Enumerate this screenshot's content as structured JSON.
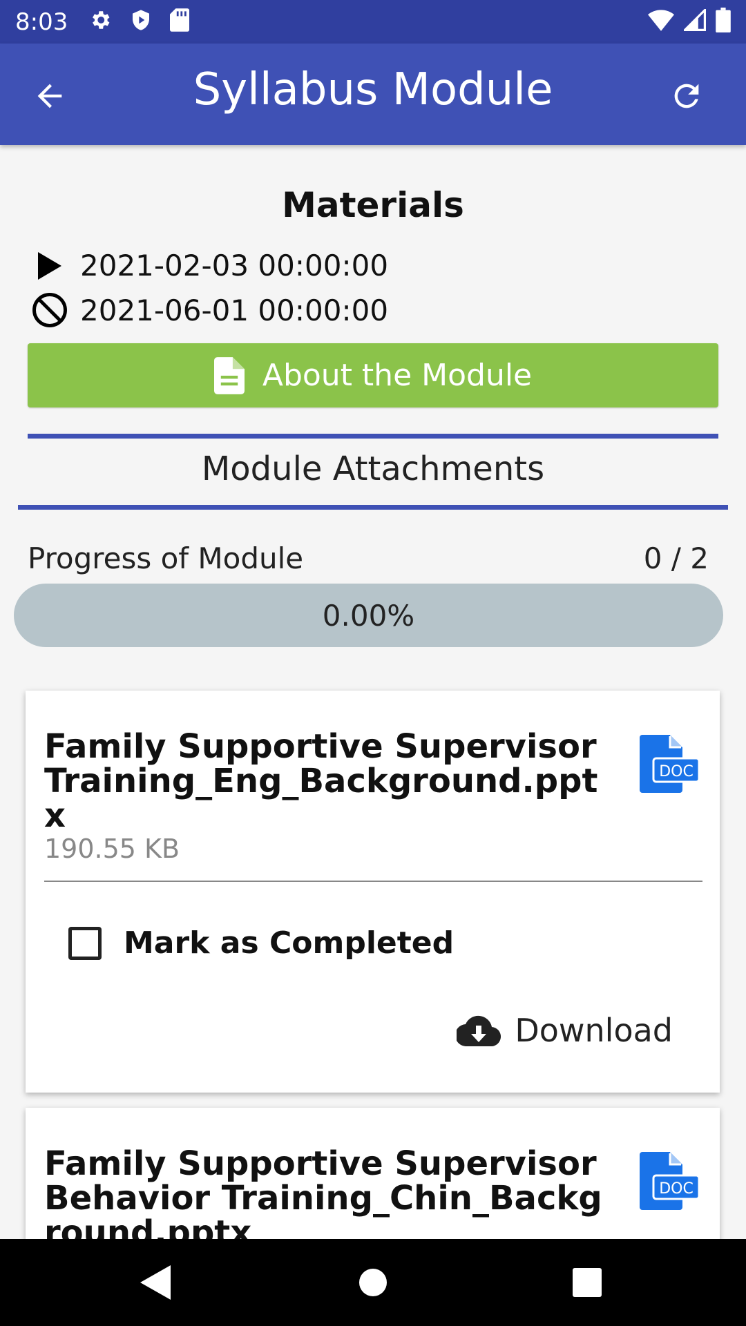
{
  "status_bar": {
    "time": "8:03",
    "left_icons": [
      "gear-icon",
      "shield-play-icon",
      "sd-card-icon"
    ],
    "right_icons": [
      "wifi-icon",
      "signal-icon",
      "battery-icon"
    ]
  },
  "app_bar": {
    "title": "Syllabus Module",
    "back_icon": "arrow-back-icon",
    "refresh_icon": "refresh-icon",
    "color": "#3f51b5",
    "status_color": "#303f9f"
  },
  "materials": {
    "title": "Materials",
    "start_date": "2021-02-03 00:00:00",
    "end_date": "2021-06-01 00:00:00",
    "about_button": "About the Module",
    "about_button_color": "#8bc34a"
  },
  "attachments": {
    "title": "Module Attachments",
    "progress_label": "Progress of Module",
    "progress_count": "0 / 2",
    "progress_text": "0.00%",
    "progress_value": 0.0,
    "progress_track_color": "#b6c4ca"
  },
  "cards": [
    {
      "name": "Family Supportive Supervisor Training_Eng_Background.pptx",
      "size": "190.55 KB",
      "mark_label": "Mark as Completed",
      "checked": false,
      "download_label": "Download",
      "icon": "doc-file-icon",
      "icon_color": "#1a73e8"
    },
    {
      "name": "Family Supportive Supervisor Behavior Training_Chin_Background.pptx",
      "icon": "doc-file-icon",
      "icon_color": "#1a73e8"
    }
  ],
  "nav_bar": {
    "buttons": [
      "nav-back-icon",
      "nav-home-icon",
      "nav-recents-icon"
    ]
  }
}
